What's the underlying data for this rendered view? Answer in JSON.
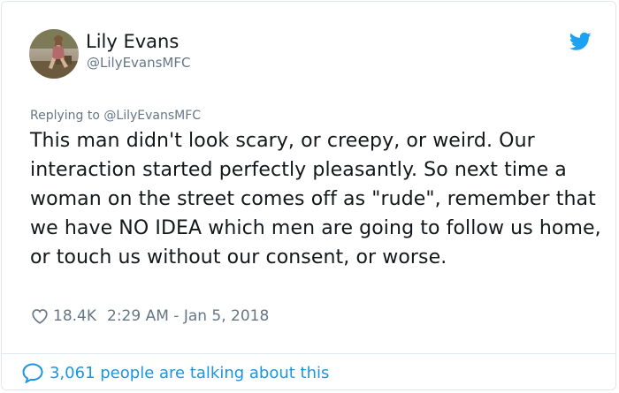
{
  "user": {
    "name": "Lily Evans",
    "handle": "@LilyEvansMFC"
  },
  "reply": {
    "prefix": "Replying to",
    "to": "@LilyEvansMFC"
  },
  "tweet": {
    "text": "This man didn't look scary, or creepy, or weird. Our interaction started perfectly pleasantly. So next time a woman on the street comes off as \"rude\", remember that we have NO IDEA which men are going to follow us home, or touch us without our consent, or worse."
  },
  "meta": {
    "likes": "18.4K",
    "timestamp": "2:29 AM - Jan 5, 2018"
  },
  "footer": {
    "conversation": "3,061 people are talking about this"
  },
  "icons": {
    "brand": "twitter-bird-icon",
    "like": "heart-outline-icon",
    "conversation": "speech-bubble-icon"
  },
  "colors": {
    "brand_blue": "#1da1f2",
    "link_blue": "#1b95e0",
    "secondary_gray": "#657786",
    "text": "#14171a",
    "border": "#e1e8ed"
  }
}
